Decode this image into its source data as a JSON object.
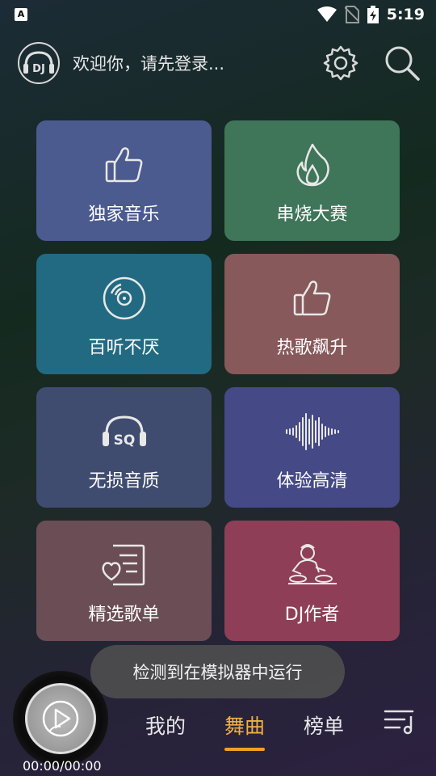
{
  "status_bar": {
    "app_icon_letter": "A",
    "time": "5:19",
    "icons": [
      "wifi-icon",
      "no-sim-icon",
      "battery-charging-icon"
    ]
  },
  "header": {
    "logo_text": "DJ",
    "welcome_text": "欢迎你，请先登录...",
    "icons": [
      "gear-icon",
      "search-icon"
    ]
  },
  "tiles": [
    {
      "label": "独家音乐",
      "icon": "thumbs-up-icon",
      "color": "#4b5b8f"
    },
    {
      "label": "串烧大赛",
      "icon": "flame-icon",
      "color": "#3f7559"
    },
    {
      "label": "百听不厌",
      "icon": "disc-icon",
      "color": "#226a82"
    },
    {
      "label": "热歌飙升",
      "icon": "thumbs-up-icon",
      "color": "#87595a"
    },
    {
      "label": "无损音质",
      "icon": "sq-headphones-icon",
      "color": "#3f4c70"
    },
    {
      "label": "体验高清",
      "icon": "waveform-icon",
      "color": "#454986"
    },
    {
      "label": "精选歌单",
      "icon": "playlist-heart-icon",
      "color": "#6b4d55"
    },
    {
      "label": "DJ作者",
      "icon": "dj-artist-icon",
      "color": "#8e3f57"
    }
  ],
  "toast": "检测到在模拟器中运行",
  "player": {
    "time": "00:00/00:00",
    "icon": "play-icon"
  },
  "bottom_tabs": [
    {
      "label": "我的",
      "active": false
    },
    {
      "label": "舞曲",
      "active": true
    },
    {
      "label": "榜单",
      "active": false
    }
  ],
  "colors": {
    "accent": "#f0a020"
  }
}
